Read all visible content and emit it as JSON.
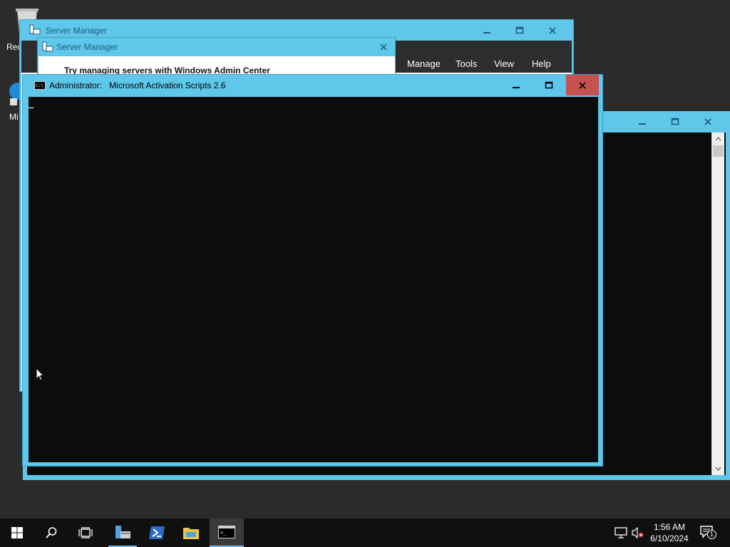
{
  "desktop": {
    "icons": [
      {
        "name": "recycle-bin",
        "label": "Rec"
      },
      {
        "name": "edge",
        "label": "Mi"
      }
    ]
  },
  "server_manager": {
    "title": "Server Manager",
    "menu": [
      "Manage",
      "Tools",
      "View",
      "Help"
    ]
  },
  "dialog": {
    "title": "Server Manager",
    "text": "Try managing servers with Windows Admin Center"
  },
  "console": {
    "title_user": "Administrator:",
    "title_app": "Microsoft Activation Scripts 2.6",
    "cursor": "_"
  },
  "taskbar": {
    "time": "1:56 AM",
    "date": "6/10/2024",
    "notification_count": "1"
  },
  "colors": {
    "title_active": "#5ec7ea",
    "close_hover": "#c75050",
    "console_bg": "#0c0c0c",
    "taskbar_bg": "#101010"
  }
}
